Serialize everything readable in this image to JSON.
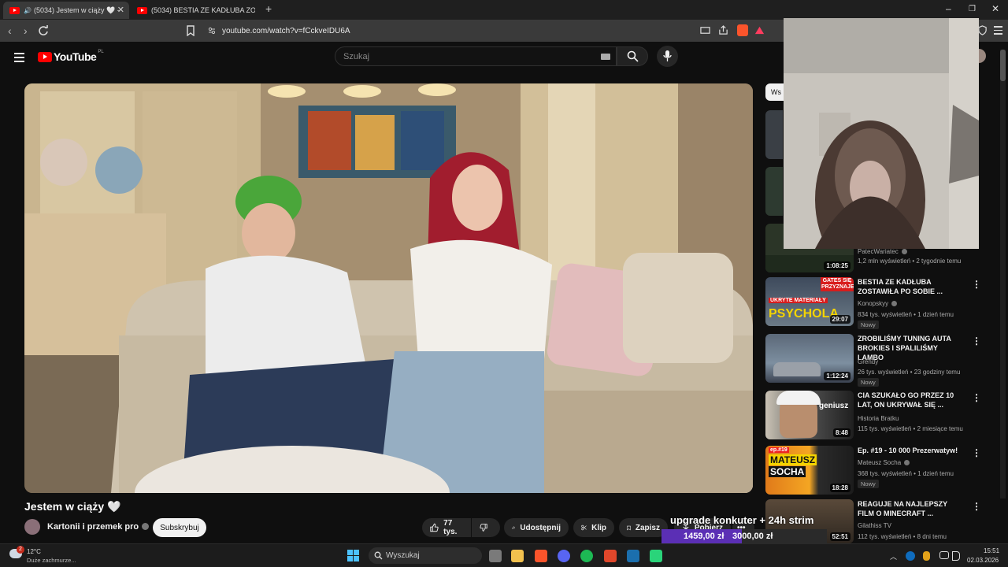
{
  "browser": {
    "tabs": [
      {
        "label": "(5034) Jestem w ciąży 🤍 - Yo",
        "active": true
      },
      {
        "label": "(5034) BESTIA ZE KADŁUBA ZOSTAW",
        "active": false
      }
    ],
    "new_tab": "+",
    "url": "youtube.com/watch?v=fCckveIDU6A",
    "window_controls": [
      "–",
      "❐",
      "✕"
    ]
  },
  "youtube": {
    "logo_text": "YouTube",
    "region": "PL",
    "search_placeholder": "Szukaj",
    "filter_chip": "Ws"
  },
  "video": {
    "title": "Jestem w ciąży 🤍",
    "channel": "Kartonii i przemek pro",
    "subscribe_label": "Subskrybuj",
    "likes": "77 tys.",
    "share_label": "Udostępnij",
    "clip_label": "Klip",
    "save_label": "Zapisz",
    "download_label": "Pobierz",
    "more_label": "•••"
  },
  "sidebar": [
    {
      "title": "",
      "channel": "PatecWariatec",
      "meta": "1,2 mln wyświetleń • 2 tygodnie temu",
      "duration": "1:08:25",
      "new": ""
    },
    {
      "title": "BESTIA ZE KADŁUBA ZOSTAWIŁA PO SOBIE ...",
      "channel": "Konopskyy",
      "meta": "834 tys. wyświetleń • 1 dzień temu",
      "duration": "29:07",
      "new": "Nowy",
      "thumb_text": "PSYCHOLA",
      "thumb_text2": "UKRYTE MATERIAŁY",
      "thumb_text3": "GATES SIĘ PRZYZNAJE"
    },
    {
      "title": "ZROBILIŚMY TUNING AUTA BROKIES I SPALILIŚMY LAMBO",
      "channel": "Grendy",
      "meta": "26 tys. wyświetleń • 23 godziny temu",
      "duration": "1:12:24",
      "new": "Nowy"
    },
    {
      "title": "CIA SZUKAŁO GO PRZEZ 10 LAT, ON UKRYWAŁ SIĘ ...",
      "channel": "Historia Bratku",
      "meta": "115 tys. wyświetleń • 2 miesiące temu",
      "duration": "8:48",
      "new": "",
      "thumb_text": "geniusz"
    },
    {
      "title": "Ep. #19 - 10 000 Prezerwatyw!",
      "channel": "Mateusz Socha",
      "meta": "368 tys. wyświetleń • 1 dzień temu",
      "duration": "18:28",
      "new": "Nowy",
      "thumb_text": "MATEUSZ",
      "thumb_text2": "SOCHA",
      "thumb_text3": "ep.#19"
    },
    {
      "title": "REAGUJE NA NAJLEPSZY FILM O MINECRAFT ...",
      "channel": "Gilathiss TV",
      "meta": "112 tys. wyświetleń • 8 dni temu",
      "duration": "52:51",
      "new": ""
    }
  ],
  "stream_overlay": {
    "goal_text": "upgrade konkuter + 24h strim",
    "current": "1459,00 zł",
    "target": "3000,00 zł",
    "progress": 0.486
  },
  "taskbar": {
    "weather_temp": "12°C",
    "weather_desc": "Duże zachmurze...",
    "weather_badge": "2",
    "search_label": "Wyszukaj",
    "time": "15:51",
    "date": "02.03.2026"
  },
  "colors": {
    "yt_red": "#ff0000",
    "goal_fill": "#5b2fb5"
  }
}
